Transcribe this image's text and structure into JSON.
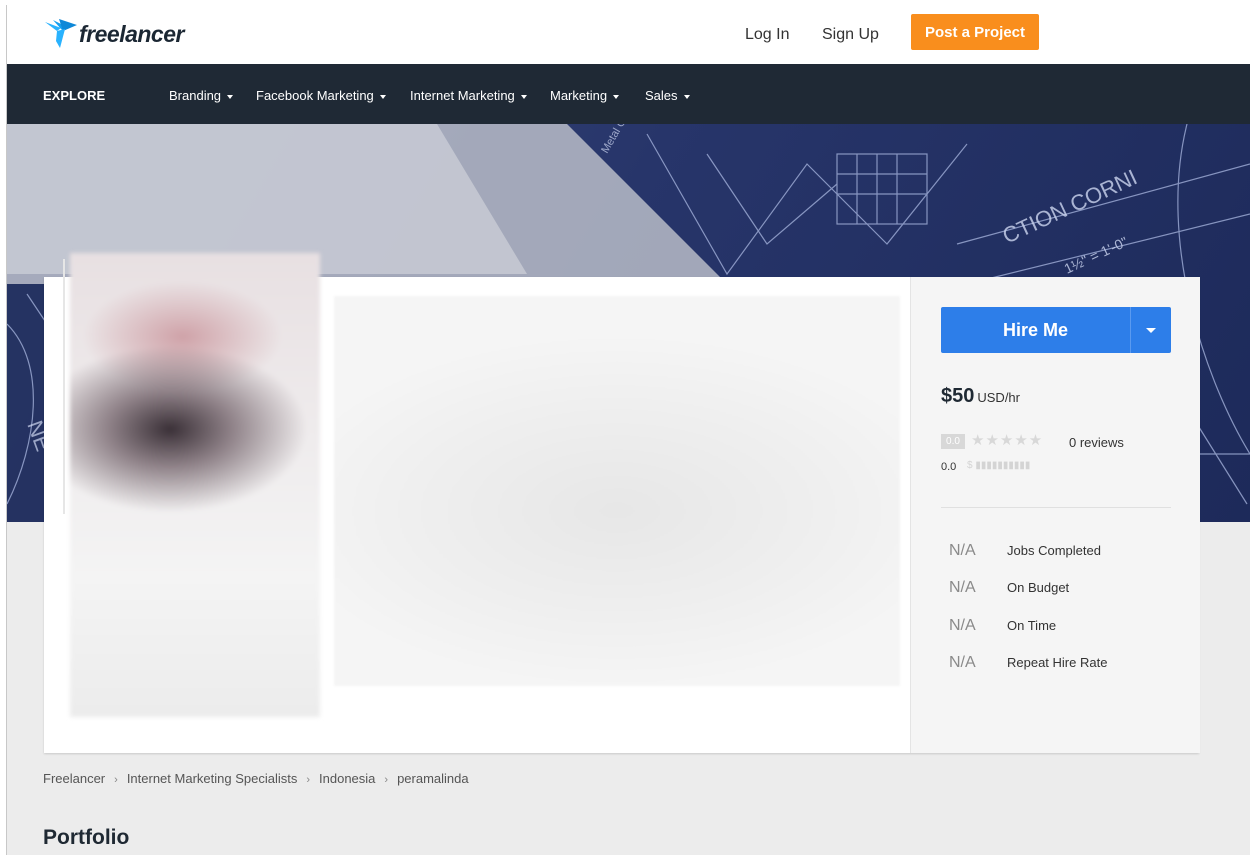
{
  "header": {
    "logo_text": "freelancer",
    "login_label": "Log In",
    "signup_label": "Sign Up",
    "post_project_label": "Post a Project"
  },
  "nav": {
    "explore_label": "EXPLORE",
    "categories": [
      "Branding",
      "Facebook Marketing",
      "Internet Marketing",
      "Marketing",
      "Sales"
    ]
  },
  "profile": {
    "hire_label": "Hire Me",
    "rate_amount": "$50",
    "rate_unit": "USD/hr",
    "rating_badge": "0.0",
    "reviews": "0 reviews",
    "earnings_score": "0.0",
    "stats": [
      {
        "value": "N/A",
        "label": "Jobs Completed"
      },
      {
        "value": "N/A",
        "label": "On Budget"
      },
      {
        "value": "N/A",
        "label": "On Time"
      },
      {
        "value": "N/A",
        "label": "Repeat Hire Rate"
      }
    ]
  },
  "breadcrumb": [
    "Freelancer",
    "Internet Marketing Specialists",
    "Indonesia",
    "peramalinda"
  ],
  "portfolio_heading": "Portfolio",
  "colors": {
    "brand_blue": "#2d7ee9",
    "post_orange": "#f98e1d",
    "nav_dark": "#1f2935"
  }
}
